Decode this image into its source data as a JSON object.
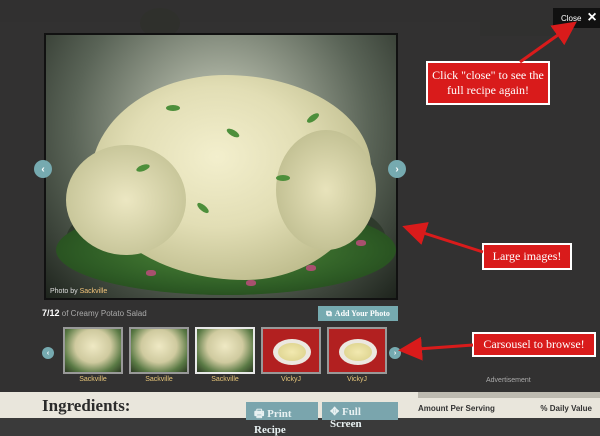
{
  "page": {
    "ingredients_heading": "Ingredients:",
    "print_recipe_label": "Print Recipe",
    "full_screen_label": "Full Screen",
    "nutrition": {
      "amount_per_serving": "Amount Per Serving",
      "daily_value": "% Daily Value"
    }
  },
  "lightbox": {
    "close_label": "Close",
    "close_icon": "×",
    "photo_credit_prefix": "Photo by",
    "photo_credit_author": "Sackville",
    "counter": "7/12",
    "counter_suffix": "of Creamy Potato Salad",
    "add_photo_label": "Add Your Photo",
    "prev_icon": "‹",
    "next_icon": "›",
    "thumbnails": [
      {
        "author": "Sackville",
        "type": "potato",
        "active": false
      },
      {
        "author": "Sackville",
        "type": "potato",
        "active": false
      },
      {
        "author": "Sackville",
        "type": "potato",
        "active": true
      },
      {
        "author": "VickyJ",
        "type": "bowl",
        "active": false
      },
      {
        "author": "VickyJ",
        "type": "bowl",
        "active": false
      }
    ],
    "advertisement": "Advertisement"
  },
  "callouts": {
    "close": "Click \"close\" to see the full recipe again!",
    "large_images": "Large images!",
    "carousel": "Carsousel to browse!"
  },
  "colors": {
    "accent": "#76aab0",
    "callout_red": "#d91b1b",
    "author_gold": "#e8c77a"
  }
}
